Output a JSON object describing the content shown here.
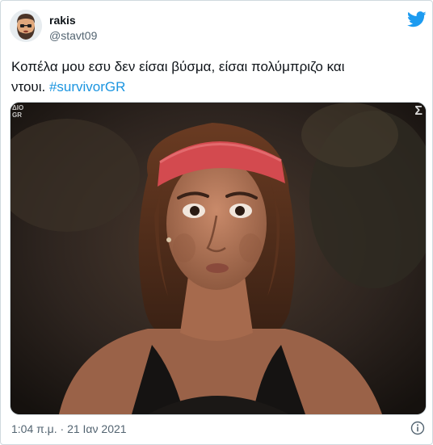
{
  "author": {
    "display_name": "rakis",
    "handle": "@stavt09",
    "avatar_icon": "bearded-man-avatar-icon"
  },
  "brand": {
    "logo_icon": "twitter-bird-icon",
    "color": "#1d9bf0"
  },
  "tweet": {
    "text_line1": "Κοπέλα μου εσυ δεν είσαι βύσμα, είσαι πολύμπριζο και",
    "text_line2": "ντουι. ",
    "hashtag": "#survivorGR",
    "hashtag_color": "#1b95e0"
  },
  "media": {
    "channel_left_line1": "ΔΙΟ",
    "channel_left_line2": "GR",
    "channel_right": "Σ",
    "description_icon": "woman-red-headband-photo"
  },
  "footer": {
    "timestamp": "1:04 π.μ. · 21 Ιαν 2021",
    "info_icon": "info-icon"
  }
}
